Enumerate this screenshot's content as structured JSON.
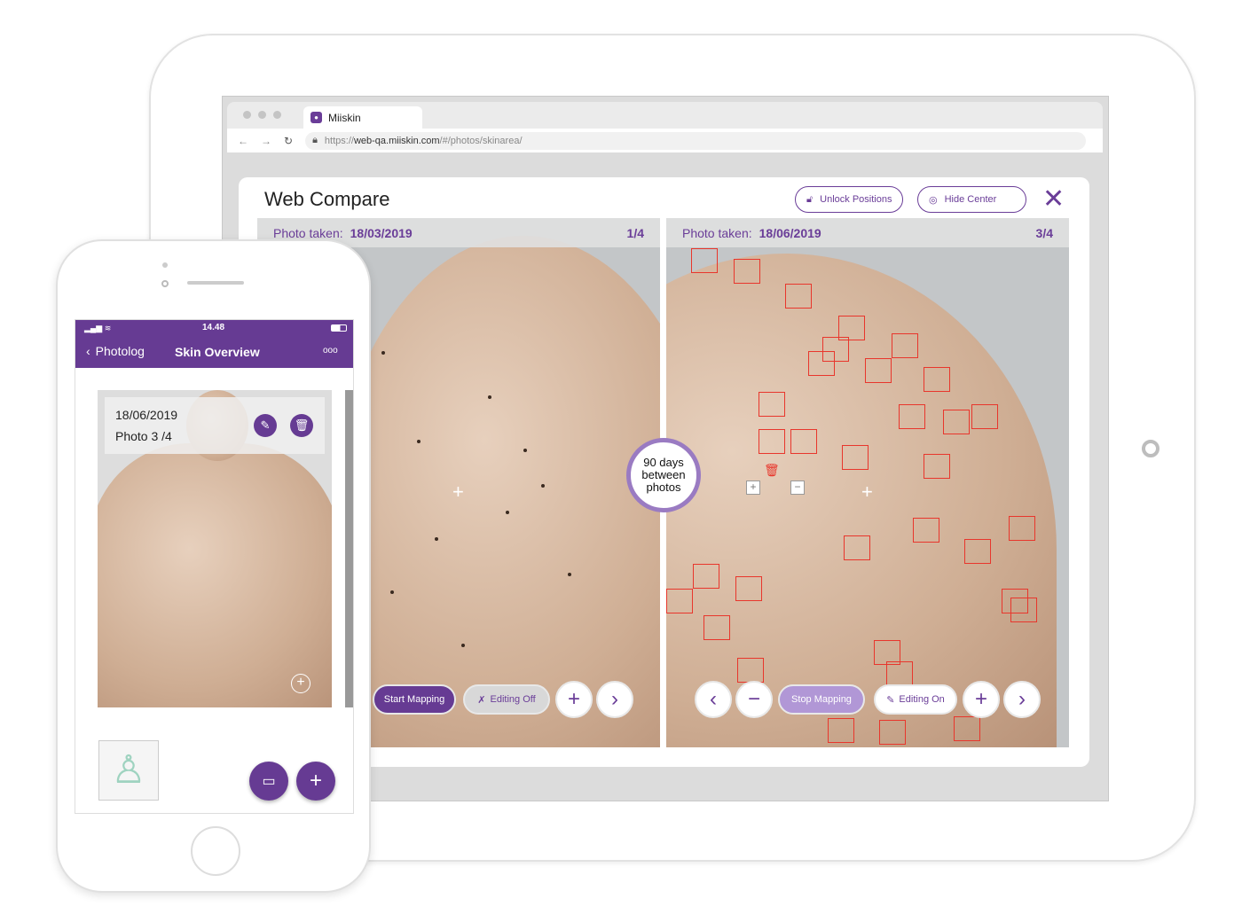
{
  "browser": {
    "tab_title": "Miiskin",
    "url_prefix": "https://",
    "url_host": "web-qa.miiskin.com",
    "url_path": "/#/photos/skinarea/"
  },
  "compare": {
    "title": "Web Compare",
    "unlock_label": "Unlock Positions",
    "hide_center_label": "Hide Center",
    "left": {
      "photo_label": "Photo taken:",
      "date": "18/03/2019",
      "index": "1/4",
      "start_mapping": "Start Mapping",
      "editing": "Editing Off"
    },
    "right": {
      "photo_label": "Photo taken:",
      "date": "18/06/2019",
      "index": "3/4",
      "stop_mapping": "Stop Mapping",
      "editing": "Editing On"
    },
    "gap_badge": {
      "line1": "90 days",
      "line2": "between",
      "line3": "photos"
    }
  },
  "phone": {
    "time": "14.48",
    "back_label": "Photolog",
    "title": "Skin Overview",
    "more": "ooo",
    "card": {
      "date": "18/06/2019",
      "photo": "Photo 3 /4"
    }
  },
  "colors": {
    "brand": "#663b93",
    "light_brand": "#b197d6",
    "marker": "#e8362c"
  }
}
